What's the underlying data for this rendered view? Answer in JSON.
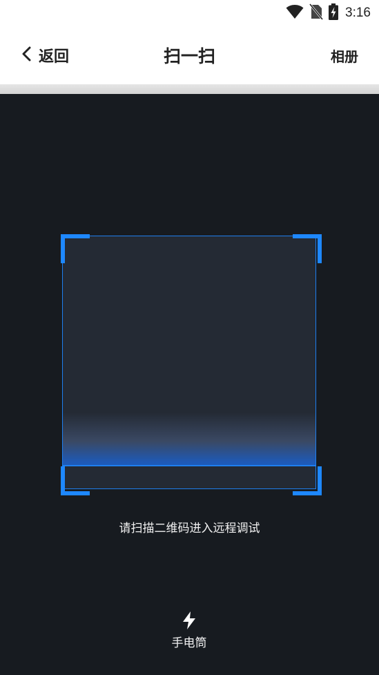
{
  "status_bar": {
    "time": "3:16",
    "icons": [
      "wifi-icon",
      "no-sim-icon",
      "battery-charging-icon"
    ]
  },
  "header": {
    "back_label": "返回",
    "title": "扫一扫",
    "album_label": "相册"
  },
  "scanner": {
    "hint": "请扫描二维码进入远程调试",
    "accent_color": "#1e88ff",
    "background_color": "#171b20"
  },
  "flashlight": {
    "icon": "flash-icon",
    "label": "手电筒"
  }
}
